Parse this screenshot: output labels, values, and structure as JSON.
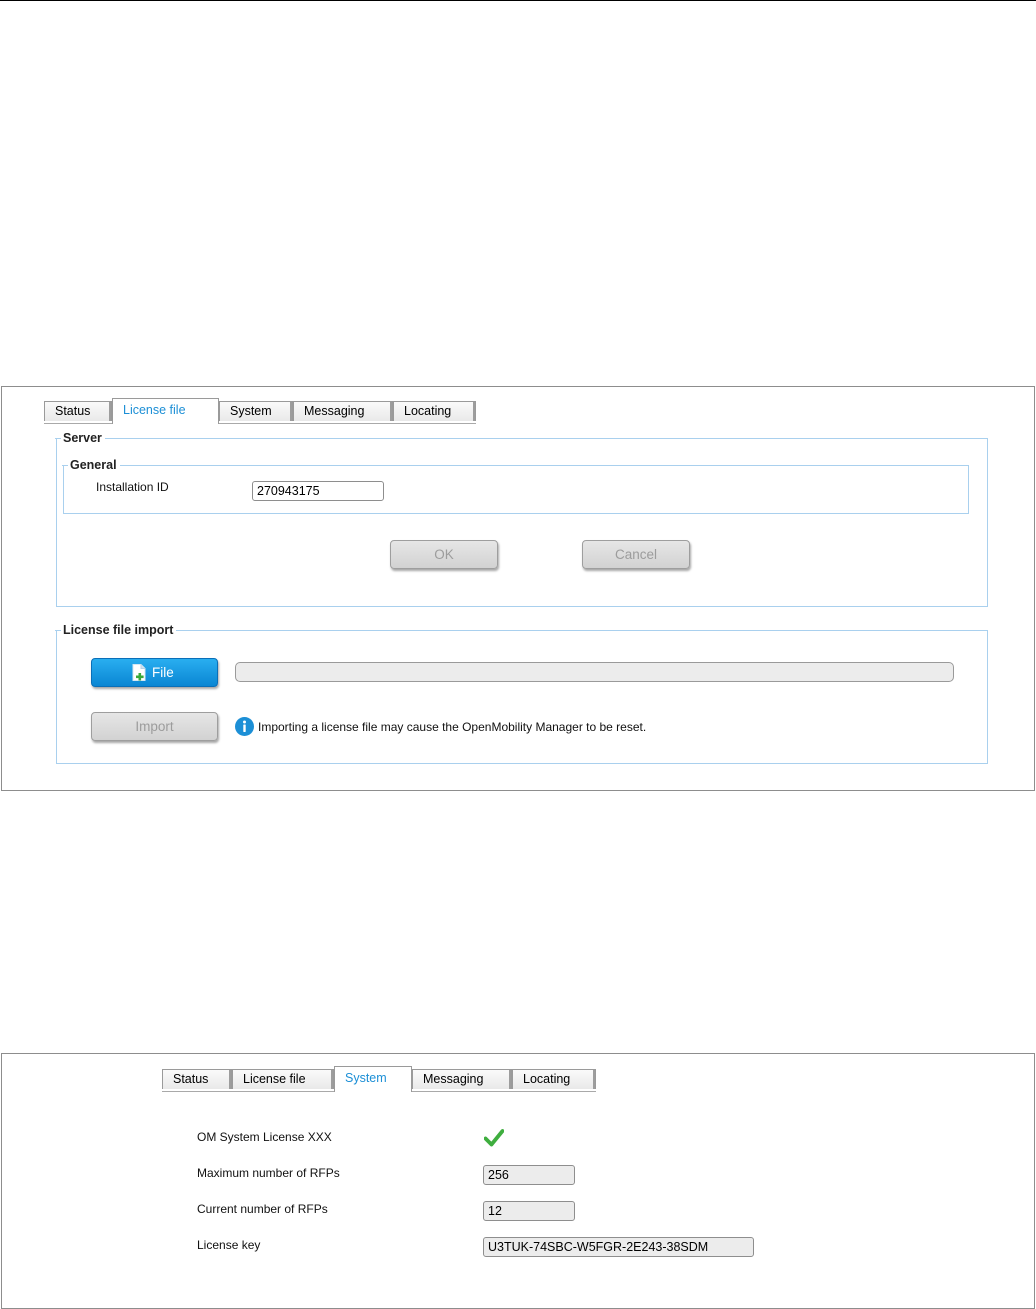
{
  "license_panel": {
    "tabs": [
      {
        "label": "Status"
      },
      {
        "label": "License file",
        "active": true
      },
      {
        "label": "System"
      },
      {
        "label": "Messaging"
      },
      {
        "label": "Locating"
      }
    ],
    "server": {
      "legend": "Server",
      "general": {
        "legend": "General",
        "installation_id_label": "Installation ID",
        "installation_id_value": "270943175"
      },
      "ok_label": "OK",
      "cancel_label": "Cancel"
    },
    "import": {
      "legend": "License file import",
      "file_label": "File",
      "import_label": "Import",
      "progress": 0,
      "info_text": "Importing a license file may cause the OpenMobility Manager to be reset."
    }
  },
  "system_panel": {
    "tabs": [
      {
        "label": "Status"
      },
      {
        "label": "License file"
      },
      {
        "label": "System",
        "active": true
      },
      {
        "label": "Messaging"
      },
      {
        "label": "Locating"
      }
    ],
    "rows": {
      "om_system_license_label": "OM System License XXX",
      "om_system_license_status": "valid",
      "max_rfps_label": "Maximum number of RFPs",
      "max_rfps_value": "256",
      "current_rfps_label": "Current number of RFPs",
      "current_rfps_value": "12",
      "license_key_label": "License key",
      "license_key_value": "U3TUK-74SBC-W5FGR-2E243-38SDM"
    }
  },
  "colors": {
    "accent_blue": "#1c8fd6",
    "fieldset_border": "#a9d0ee",
    "check_green": "#3fae3f"
  },
  "icons": {
    "file": "file-add-icon",
    "info": "info-icon",
    "check": "checkmark-icon"
  }
}
